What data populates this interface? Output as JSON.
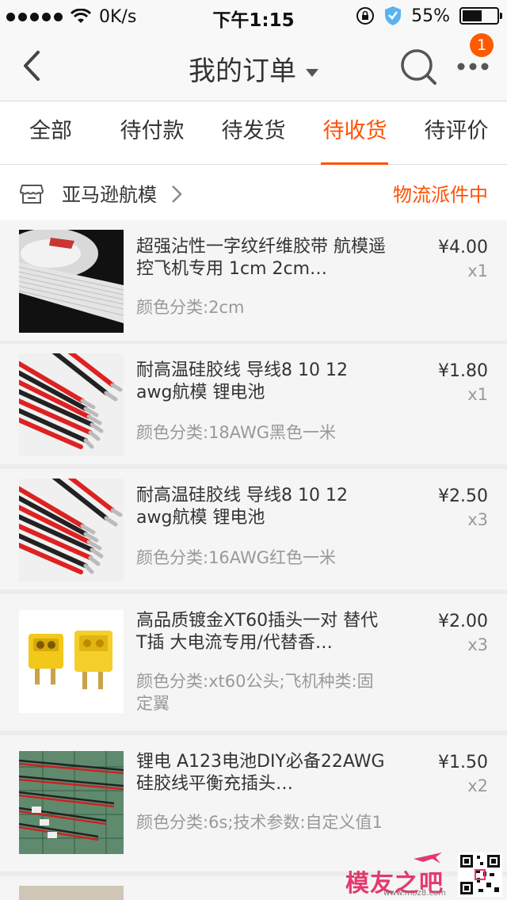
{
  "status_bar": {
    "network": "0K/s",
    "time": "下午1:15",
    "battery": "55%"
  },
  "nav": {
    "title": "我的订单",
    "badge": "1"
  },
  "tabs": [
    {
      "label": "全部"
    },
    {
      "label": "待付款"
    },
    {
      "label": "待发货"
    },
    {
      "label": "待收货",
      "active": true
    },
    {
      "label": "待评价"
    }
  ],
  "shop": {
    "name": "亚马逊航模",
    "status": "物流派件中"
  },
  "items": [
    {
      "title": "超强沾性一字纹纤维胶带 航模遥控飞机专用 1cm 2cm…",
      "sku": "颜色分类:2cm",
      "price": "¥4.00",
      "qty": "x1"
    },
    {
      "title": "耐高温硅胶线 导线8 10 12 awg航模 锂电池",
      "sku": "颜色分类:18AWG黑色一米",
      "price": "¥1.80",
      "qty": "x1"
    },
    {
      "title": "耐高温硅胶线 导线8 10 12 awg航模 锂电池",
      "sku": "颜色分类:16AWG红色一米",
      "price": "¥2.50",
      "qty": "x3"
    },
    {
      "title": "高品质镀金XT60插头一对 替代T插 大电流专用/代替香…",
      "sku": "颜色分类:xt60公头;飞机种类:固定翼",
      "price": "¥2.00",
      "qty": "x3"
    },
    {
      "title": "锂电 A123电池DIY必备22AWG硅胶线平衡充插头…",
      "sku": "颜色分类:6s;技术参数:自定义值1",
      "price": "¥1.50",
      "qty": "x2"
    }
  ],
  "watermark": {
    "text": "模友之吧",
    "url": "www.moz8.com"
  },
  "colors": {
    "accent": "#ff5000",
    "badge": "#ff5a00"
  }
}
